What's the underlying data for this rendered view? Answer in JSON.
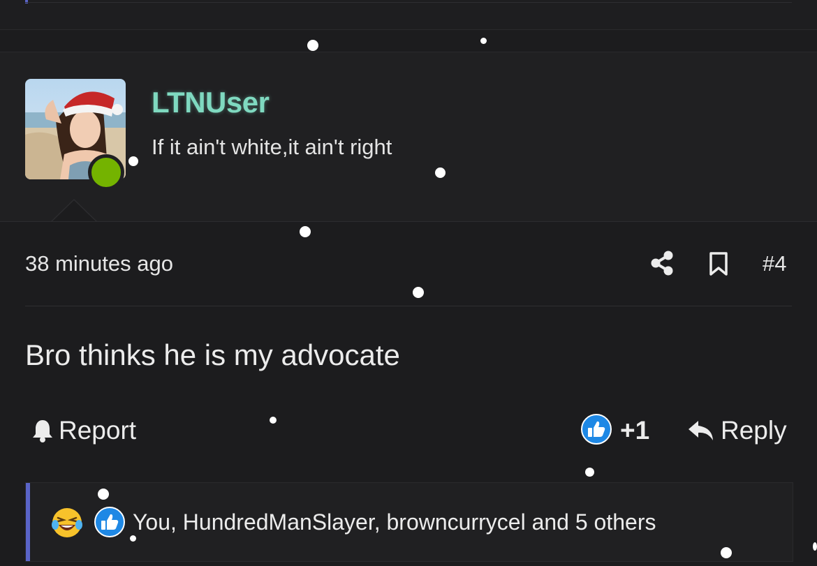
{
  "post": {
    "user": {
      "name": "LTNUser",
      "title": "If it ain't white,it ain't right",
      "online": true
    },
    "time": "38 minutes ago",
    "number": "#4",
    "message": "Bro thinks he is my advocate",
    "actions": {
      "report": "Report",
      "like_count": "+1",
      "reply": "Reply"
    },
    "reactions": {
      "summary": "You, HundredManSlayer, browncurrycel and 5 others",
      "icons": [
        "laughing-emoji-icon",
        "like-icon"
      ]
    }
  },
  "colors": {
    "background": "#1c1c1e",
    "username": "#7fd9c0",
    "online": "#74b300",
    "accent_bar": "#5a64c8",
    "like_blue": "#1e88e5"
  }
}
